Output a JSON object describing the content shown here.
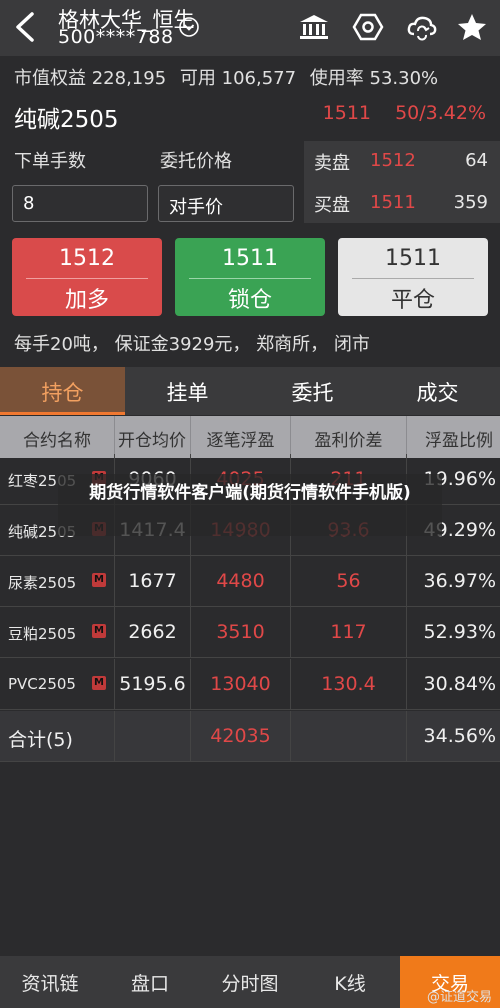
{
  "header": {
    "account_name": "格林大华_恒生",
    "account_no": "500****788",
    "icons": [
      "back-icon",
      "chevron-down-circle-icon",
      "bank-icon",
      "settings-hex-icon",
      "cloud-sync-icon",
      "star-icon"
    ]
  },
  "summary": {
    "equity": "市值权益 228,195",
    "available": "可用 106,577",
    "usage": "使用率 53.30%"
  },
  "contract": {
    "name": "纯碱2505",
    "last_price": "1511",
    "change": "50/3.42%"
  },
  "order_form": {
    "qty_label": "下单手数",
    "qty_value": "8",
    "price_label": "委托价格",
    "price_value": "对手价"
  },
  "order_book": [
    {
      "side": "卖盘",
      "price": "1512",
      "qty": "64"
    },
    {
      "side": "买盘",
      "price": "1511",
      "qty": "359"
    }
  ],
  "trade_buttons": [
    {
      "price": "1512",
      "action": "加多"
    },
    {
      "price": "1511",
      "action": "锁仓"
    },
    {
      "price": "1511",
      "action": "平仓"
    }
  ],
  "info_line": "每手20吨， 保证金3929元， 郑商所， 闭市",
  "tabs": [
    "持仓",
    "挂单",
    "委托",
    "成交"
  ],
  "table": {
    "headers": [
      "合约名称",
      "开仓均价",
      "逐笔浮盈",
      "盈利价差",
      "浮盈比例"
    ],
    "rows": [
      {
        "name": "红枣2505",
        "badge": "M",
        "avg": "9060",
        "pnl": "4025",
        "diff": "211",
        "ratio": "19.96%"
      },
      {
        "name": "纯碱2505",
        "badge": "M",
        "avg": "1417.4",
        "pnl": "14980",
        "diff": "93.6",
        "ratio": "49.29%"
      },
      {
        "name": "尿素2505",
        "badge": "M",
        "avg": "1677",
        "pnl": "4480",
        "diff": "56",
        "ratio": "36.97%"
      },
      {
        "name": "豆粕2505",
        "badge": "M",
        "avg": "2662",
        "pnl": "3510",
        "diff": "117",
        "ratio": "52.93%"
      },
      {
        "name": "PVC2505",
        "badge": "M",
        "avg": "5195.6",
        "pnl": "13040",
        "diff": "130.4",
        "ratio": "30.84%"
      }
    ],
    "total": {
      "label": "合计(5)",
      "pnl": "42035",
      "ratio": "34.56%"
    }
  },
  "watermark": "期货行情软件客户端(期货行情软件手机版)",
  "bottom_nav": [
    "资讯链",
    "盘口",
    "分时图",
    "K线",
    "交易"
  ],
  "corner_mark": "@证道交易",
  "colors": {
    "up_red": "#e04848",
    "accent_orange": "#f07a1a",
    "lock_green": "#3aa354"
  }
}
